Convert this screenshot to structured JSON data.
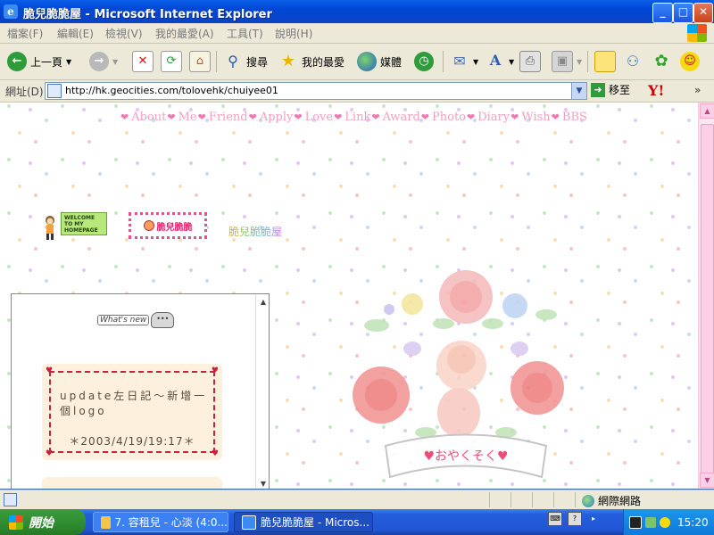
{
  "window": {
    "title": "脆兒脆脆屋 - Microsoft Internet Explorer",
    "controls": {
      "minimize": "_",
      "maximize": "□",
      "close": "✕"
    }
  },
  "menubar": {
    "items": [
      "檔案(F)",
      "編輯(E)",
      "檢視(V)",
      "我的最愛(A)",
      "工具(T)",
      "說明(H)"
    ]
  },
  "toolbar": {
    "back_label": "上一頁",
    "search_label": "搜尋",
    "favorites_label": "我的最愛",
    "media_label": "媒體"
  },
  "addressbar": {
    "label": "網址(D)",
    "url": "http://hk.geocities.com/tolovehk/chuiyee01",
    "go_label": "移至",
    "yahoo": "Y!",
    "more": "»"
  },
  "page": {
    "nav": [
      "About",
      "Me",
      "Friend",
      "Apply",
      "Love",
      "Link",
      "Award",
      "Photo",
      "Diary",
      "Wish",
      "BBS"
    ],
    "welcome_banner": "WELCOME TO MY HOMEPAGE",
    "logo_banner": "脆兒脆脆",
    "rainbow_text": "脆兒脆脆屋",
    "whats_new": "What's new",
    "ghost": "•••",
    "note": {
      "text": "update左日記～新增一個logo",
      "date": "＊2003/4/19/19:17＊"
    },
    "rose_caption": "♥おやくそく♥"
  },
  "statusbar": {
    "zone": "網際網路"
  },
  "taskbar": {
    "start": "開始",
    "tasks": [
      "7. 容租兒 - 心淡 (4:0...",
      "脆兒脆脆屋 - Micros..."
    ],
    "clock": "15:20"
  },
  "colors": {
    "nav_text": "#f3a2bd",
    "note_border": "#c8213f",
    "scrollbar": "#fbd0e6"
  }
}
